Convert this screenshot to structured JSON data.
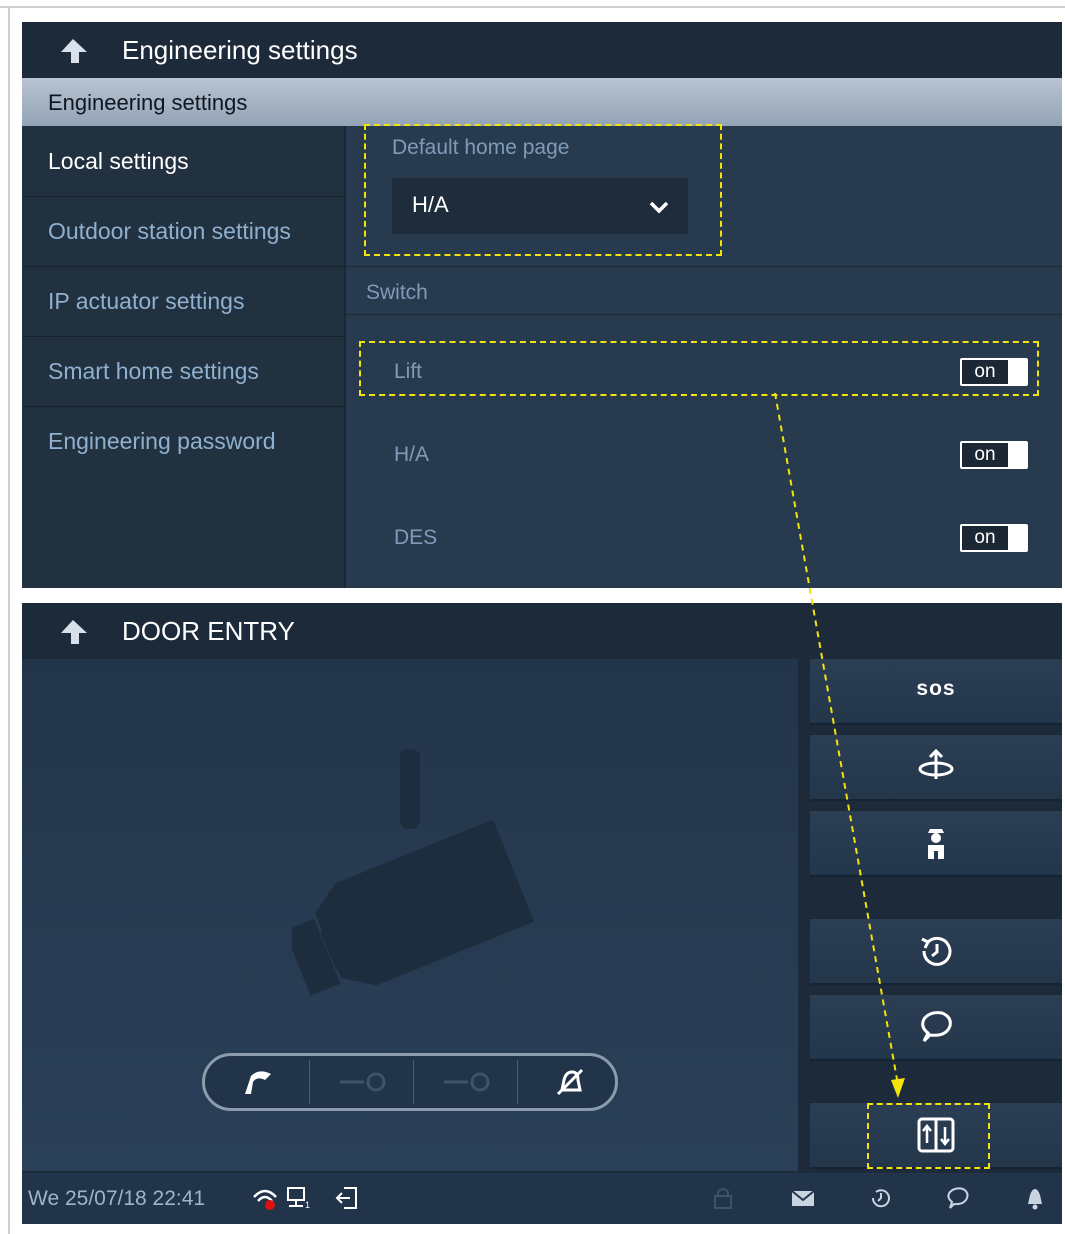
{
  "engineering": {
    "title": "Engineering settings",
    "section_title": "Engineering settings",
    "menu": [
      {
        "label": "Local settings",
        "active": true
      },
      {
        "label": "Outdoor station settings",
        "active": false
      },
      {
        "label": "IP actuator settings",
        "active": false
      },
      {
        "label": "Smart home settings",
        "active": false
      },
      {
        "label": "Engineering password",
        "active": false
      }
    ],
    "default_home_page": {
      "label": "Default home page",
      "value": "H/A"
    },
    "switch_label": "Switch",
    "switches": [
      {
        "label": "Lift",
        "state": "on"
      },
      {
        "label": "H/A",
        "state": "on"
      },
      {
        "label": "DES",
        "state": "on"
      }
    ]
  },
  "door_entry": {
    "title": "DOOR ENTRY",
    "side_buttons": [
      {
        "label": "sos",
        "icon": "sos-text"
      },
      {
        "label": "",
        "icon": "surveillance-rotate-icon"
      },
      {
        "label": "",
        "icon": "guard-icon"
      },
      {
        "label": "",
        "icon": "history-icon"
      },
      {
        "label": "",
        "icon": "message-icon"
      },
      {
        "label": "",
        "icon": "lift-icon"
      }
    ],
    "call_controls": [
      "answer-call-icon",
      "unlock-key-1-icon",
      "unlock-key-2-icon",
      "mute-icon"
    ],
    "status": {
      "datetime": "We 25/07/18  22:41",
      "icons": [
        "wifi-icon",
        "network-icon",
        "logout-icon",
        "lock-icon",
        "mail-icon",
        "history-icon",
        "chat-icon",
        "bell-icon"
      ]
    }
  },
  "colors": {
    "highlight_dash": "#f2e30b",
    "panel_bg": "#243447",
    "dim_text": "#7f9bb8"
  }
}
